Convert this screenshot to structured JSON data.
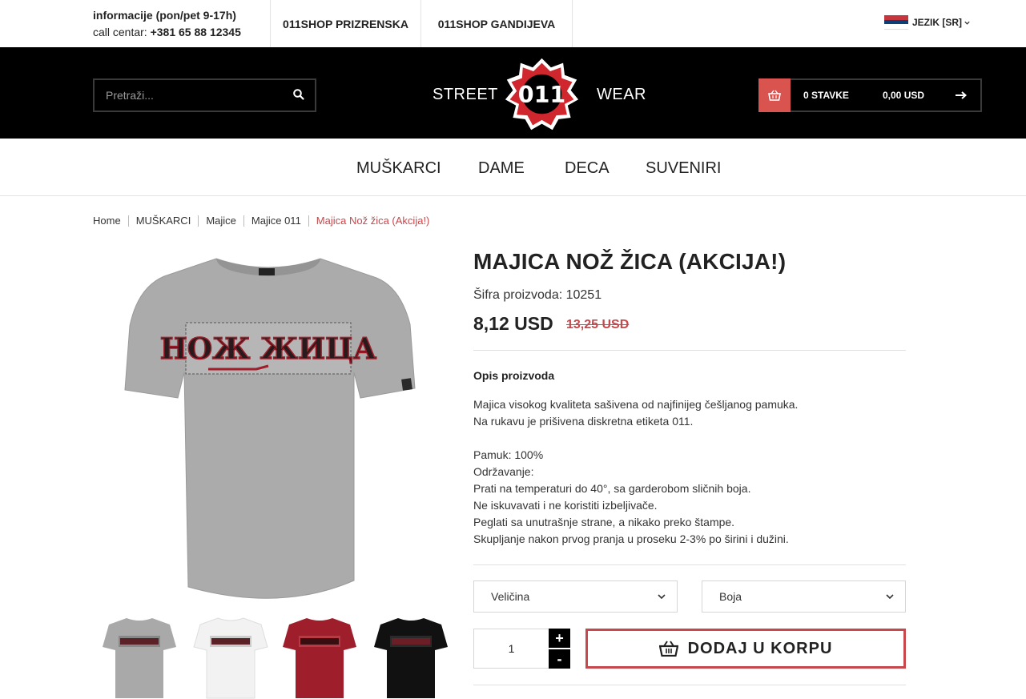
{
  "topbar": {
    "info_line1": "informacije (pon/pet 9-17h)",
    "info_line2_prefix": "call centar: ",
    "phone": "+381 65 88 12345",
    "shop1": "011SHOP PRIZRENSKA",
    "shop2": "011SHOP GANDIJEVA",
    "language": "JEZIK [SR]"
  },
  "header": {
    "search_placeholder": "Pretraži...",
    "brand_left": "STREET",
    "brand_right": "WEAR",
    "logo_text": "011",
    "cart_items": "0 STAVKE",
    "cart_total": "0,00 USD"
  },
  "nav": {
    "items": [
      "MUŠKARCI",
      "DAME",
      "DECA",
      "SUVENIRI"
    ]
  },
  "breadcrumb": {
    "items": [
      "Home",
      "MUŠKARCI",
      "Majice",
      "Majice 011"
    ],
    "current": "Majica Nož žica (Akcija!)"
  },
  "product": {
    "title": "MAJICA NOŽ ŽICA (AKCIJA!)",
    "sku": "Šifra proizvoda: 10251",
    "price": "8,12 USD",
    "old_price": "13,25 USD",
    "print_text": "НОЖ ЖИЦА",
    "desc_title": "Opis proizvoda",
    "desc_lines": [
      "Majica visokog kvaliteta sašivena od najfinijeg češljanog pamuka.",
      "Na rukavu je prišivena diskretna etiketa 011.",
      "",
      "Pamuk: 100%",
      "Održavanje:",
      "Prati na temperaturi do 40°, sa garderobom sličnih boja.",
      "Ne iskuvavati i ne koristiti izbeljivače.",
      "Peglati sa unutrašnje strane, a nikako preko štampe.",
      "Skupljanje nakon prvog pranja u proseku 2-3% po širini i dužini."
    ],
    "size_label": "Veličina",
    "color_label": "Boja",
    "quantity": "1",
    "plus": "+",
    "minus": "-",
    "add_to_cart": "DODAJ U KORPU"
  },
  "thumbnails": [
    {
      "name": "gray",
      "color": "#a9a9a9"
    },
    {
      "name": "white",
      "color": "#f2f2f2"
    },
    {
      "name": "red",
      "color": "#9e1f2b"
    },
    {
      "name": "black",
      "color": "#111111"
    }
  ],
  "colors": {
    "accent": "#c6484c",
    "header_bg": "#000000",
    "shirt_gray": "#a9a9a9"
  }
}
